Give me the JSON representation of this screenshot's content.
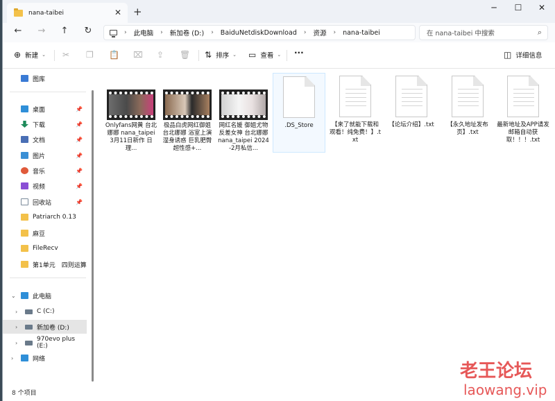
{
  "tab": {
    "title": "nana-taibei",
    "close": "✕",
    "new": "+"
  },
  "window_controls": {
    "minimize": "─",
    "maximize": "☐",
    "close": "✕"
  },
  "nav": {
    "back": "←",
    "forward": "→",
    "up": "↑",
    "refresh": "↻"
  },
  "breadcrumb": [
    "此电脑",
    "新加卷 (D:)",
    "BaiduNetdiskDownload",
    "资源",
    "nana-taibei"
  ],
  "search": {
    "placeholder": "在 nana-taibei 中搜索",
    "icon": "search-icon"
  },
  "toolbar": {
    "new_label": "新建",
    "sort_label": "排序",
    "view_label": "查看",
    "more": "···",
    "details_label": "详细信息"
  },
  "sidebar": {
    "items": [
      {
        "label": "图库",
        "icon": "gallery-icon",
        "color": "#3a7bd5"
      },
      {
        "label": "桌面",
        "icon": "desktop-icon",
        "color": "#2f8fd8",
        "pinned": true
      },
      {
        "label": "下载",
        "icon": "download-icon",
        "color": "#1e8a5a",
        "pinned": true
      },
      {
        "label": "文档",
        "icon": "documents-icon",
        "color": "#4a6fb5",
        "pinned": true
      },
      {
        "label": "图片",
        "icon": "pictures-icon",
        "color": "#3a8fd5",
        "pinned": true
      },
      {
        "label": "音乐",
        "icon": "music-icon",
        "color": "#e05a3a",
        "pinned": true
      },
      {
        "label": "视频",
        "icon": "videos-icon",
        "color": "#8a4fd5",
        "pinned": true
      },
      {
        "label": "回收站",
        "icon": "recycle-bin-icon",
        "color": "#7a8a9a",
        "pinned": true
      },
      {
        "label": "Patriarch 0.13",
        "icon": "folder-icon",
        "color": "#f3c14a"
      },
      {
        "label": "麻豆",
        "icon": "folder-icon",
        "color": "#f3c14a"
      },
      {
        "label": "FileRecv",
        "icon": "folder-icon",
        "color": "#f3c14a"
      },
      {
        "label": "第1单元　四则运算",
        "icon": "folder-icon",
        "color": "#f3c14a"
      },
      {
        "label": "此电脑",
        "icon": "this-pc-icon",
        "color": "#2f8fd8"
      },
      {
        "label": "C (C:)",
        "icon": "drive-icon",
        "color": "#6a7a8a"
      },
      {
        "label": "新加卷 (D:)",
        "icon": "drive-icon",
        "color": "#6a7a8a"
      },
      {
        "label": "970evo plus (E:)",
        "icon": "drive-icon",
        "color": "#6a7a8a"
      },
      {
        "label": "网络",
        "icon": "network-icon",
        "color": "#2f8fd8"
      }
    ]
  },
  "files": [
    {
      "name": "Onlyfans网黄 台北娜娜 nana_taipei 3月11日新作 日理...",
      "type": "video"
    },
    {
      "name": "极品白虎网红御姐 台北娜娜 浴室上演湿身诱惑 巨乳肥臀超性感+...",
      "type": "video"
    },
    {
      "name": "网红名媛 御姐尤物反差女神 台北娜娜nana_taipei 2024-2月私信...",
      "type": "video"
    },
    {
      "name": ".DS_Store",
      "type": "doc"
    },
    {
      "name": "【来了就能下载和观看！纯免费！】.txt",
      "type": "doc"
    },
    {
      "name": "【论坛介绍】.txt",
      "type": "doc"
    },
    {
      "name": "【永久地址发布页】.txt",
      "type": "doc"
    },
    {
      "name": "最新地址及APP请发邮箱自动获取！！！.txt",
      "type": "doc"
    }
  ],
  "status": {
    "count": "8 个项目"
  },
  "watermark": {
    "text": "老王论坛",
    "url": "laowang.vip"
  }
}
